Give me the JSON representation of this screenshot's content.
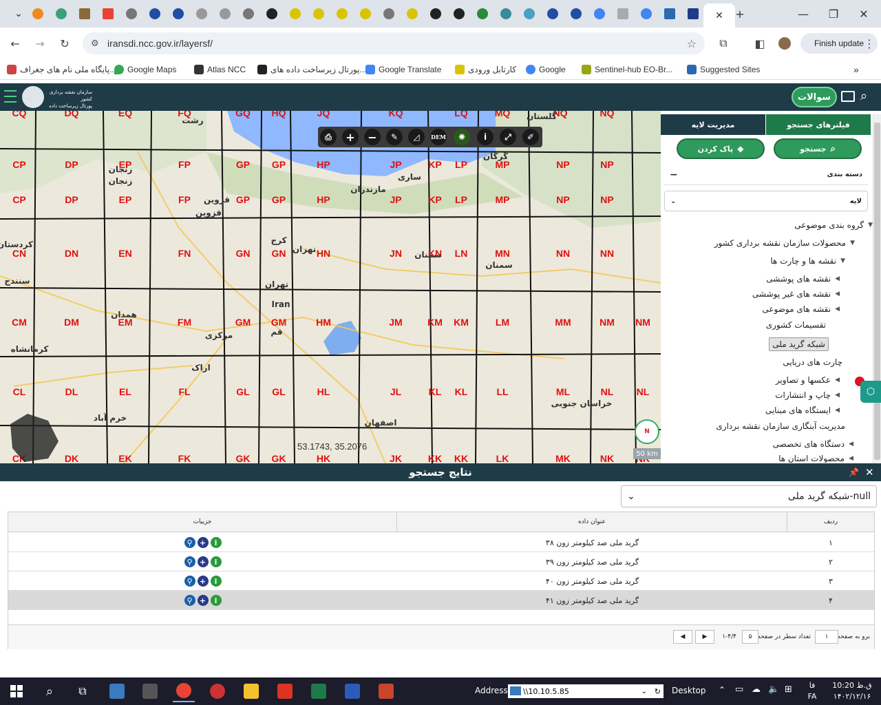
{
  "browser": {
    "url": "iransdi.ncc.gov.ir/layersf/",
    "finish_update": "Finish update",
    "bookmarks": [
      "پایگاه ملی نام های جغراف...",
      "Google Maps",
      "Atlas NCC",
      "پورتال زیرساخت داده های...",
      "Google Translate",
      "کارتابل ورودی",
      "Google",
      "Sentinel-hub EO-Br...",
      "Suggested Sites"
    ]
  },
  "header": {
    "org_line1": "سازمان نقشه برداری کشور",
    "org_line2": "پورتال زیرساخت داده های مکانی",
    "questions_button": "سوالات"
  },
  "map": {
    "coordinates": "53.1743, 35.2076",
    "scale_label": "50 km",
    "tools": [
      "print-icon",
      "zoom-in-icon",
      "zoom-out-icon",
      "draw-icon",
      "measure-icon",
      "DEM",
      "layers-icon",
      "info-icon",
      "fullscreen-icon",
      "clear-icon"
    ],
    "dem_label": "DEM",
    "grid_labels": [
      [
        "CQ",
        "DQ",
        "EQ",
        "FQ",
        "GQ",
        "HQ",
        "JQ",
        "KQ",
        "LQ",
        "MQ",
        "NQ",
        "NQ"
      ],
      [
        "CP",
        "DP",
        "EP",
        "FP",
        "GP",
        "GP",
        "HP",
        "JP",
        "KP",
        "LP",
        "MP",
        "NP",
        "NP"
      ],
      [
        "CP",
        "DP",
        "EP",
        "FP",
        "GP",
        "GP",
        "HP",
        "JP",
        "KP",
        "LP",
        "MP",
        "NP",
        "NP"
      ],
      [
        "CN",
        "DN",
        "EN",
        "FN",
        "GN",
        "GN",
        "HN",
        "JN",
        "KN",
        "LN",
        "MN",
        "NN",
        "NN"
      ],
      [
        "CM",
        "DM",
        "EM",
        "FM",
        "GM",
        "GM",
        "HM",
        "JM",
        "KM",
        "KM",
        "LM",
        "MM",
        "NM",
        "NM"
      ],
      [
        "CL",
        "DL",
        "EL",
        "FL",
        "GL",
        "GL",
        "HL",
        "JL",
        "KL",
        "KL",
        "LL",
        "ML",
        "NL",
        "NL"
      ],
      [
        "CK",
        "DK",
        "EK",
        "FK",
        "GK",
        "GK",
        "HK",
        "JK",
        "KK",
        "KK",
        "LK",
        "MK",
        "NK",
        "NK"
      ]
    ],
    "place_names": [
      "رشت",
      "گلستان",
      "زنجان",
      "زنجان",
      "گرگان",
      "ساری",
      "مازندران",
      "قزوین",
      "قزوین",
      "کردستان",
      "کرج",
      "تهران",
      "سمنان",
      "سمنان",
      "سنندج",
      "تهران",
      "Iran",
      "همدان",
      "قم",
      "مرکزی",
      "کرمانشاه",
      "اراک",
      "خراسان جنوبی",
      "خرم آباد",
      "اصفهان"
    ]
  },
  "sidebar": {
    "tab_filters": "فیلترهای جستجو",
    "tab_layers": "مدیریت لایه",
    "search_button": "جستجو",
    "clear_button": "پاک کردن",
    "category_label": "دسته بندی",
    "layer_label": "لایه",
    "tree": [
      {
        "label": "گروه بندی موضوعی"
      },
      {
        "label": "محصولات سازمان نقشه برداری کشور"
      },
      {
        "label": "نقشه ها و چارت ها"
      },
      {
        "label": "نقشه های پوششی"
      },
      {
        "label": "نقشه های غیر پوششی"
      },
      {
        "label": "نقشه های موضوعی"
      },
      {
        "label": "تقسیمات کشوری"
      },
      {
        "label": "شبکه گرید ملی"
      },
      {
        "label": "چارت های دریایی"
      },
      {
        "label": "عکسها و تصاویر"
      },
      {
        "label": "چاپ و انتشارات"
      },
      {
        "label": "ایستگاه های مبنایی"
      },
      {
        "label": "مدیریت آبنگاری سازمان نقشه برداری"
      },
      {
        "label": "دستگاه های تخصصی"
      },
      {
        "label": "محصولات استان ها"
      }
    ]
  },
  "results": {
    "title": "نتایج جستجو",
    "layer_select": "null-شبکه گرید ملی",
    "columns": {
      "row": "ردیف",
      "title": "عنوان داده",
      "details": "جزییات"
    },
    "rows": [
      {
        "n": "۱",
        "title": "گرید ملی صد کیلومتر زون ۳۸"
      },
      {
        "n": "۲",
        "title": "گرید ملی صد کیلومتر زون ۳۹"
      },
      {
        "n": "۳",
        "title": "گرید ملی صد کیلومتر زون ۴۰"
      },
      {
        "n": "۴",
        "title": "گرید ملی صد کیلومتر زون ۴۱"
      }
    ],
    "pager": {
      "goto_label": "برو به صفحه",
      "page_value": "۱",
      "rows_label": "تعداد سطر در صفحه",
      "rows_value": "۵",
      "range": "۱-۴/۴"
    }
  },
  "taskbar": {
    "address_label": "Address",
    "address_value": "\\\\10.10.5.85",
    "desktop_label": "Desktop",
    "lang": "FA",
    "time": "10:20 ق.ظ",
    "date": "۱۴۰۲/۱۲/۱۶",
    "ampm_short": "فا"
  }
}
